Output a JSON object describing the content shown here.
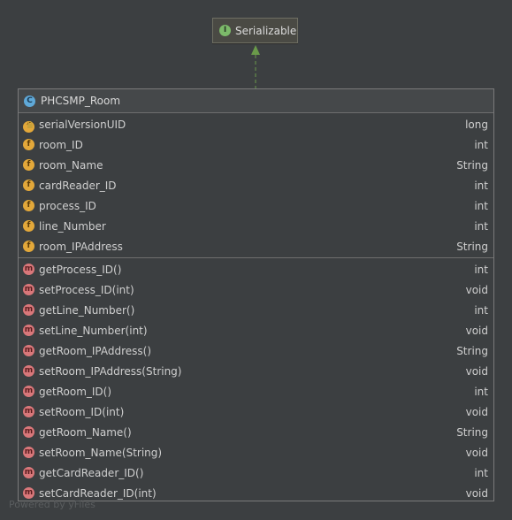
{
  "interface": {
    "name": "Serializable",
    "badge": "I"
  },
  "class": {
    "name": "PHCSMP_Room",
    "badge": "C",
    "fields": [
      {
        "name": "serialVersionUID",
        "type": "long",
        "badge": "f",
        "locked": true
      },
      {
        "name": "room_ID",
        "type": "int",
        "badge": "f"
      },
      {
        "name": "room_Name",
        "type": "String",
        "badge": "f"
      },
      {
        "name": "cardReader_ID",
        "type": "int",
        "badge": "f"
      },
      {
        "name": "process_ID",
        "type": "int",
        "badge": "f"
      },
      {
        "name": "line_Number",
        "type": "int",
        "badge": "f"
      },
      {
        "name": "room_IPAddress",
        "type": "String",
        "badge": "f"
      }
    ],
    "methods": [
      {
        "name": "getProcess_ID()",
        "type": "int",
        "badge": "m"
      },
      {
        "name": "setProcess_ID(int)",
        "type": "void",
        "badge": "m"
      },
      {
        "name": "getLine_Number()",
        "type": "int",
        "badge": "m"
      },
      {
        "name": "setLine_Number(int)",
        "type": "void",
        "badge": "m"
      },
      {
        "name": "getRoom_IPAddress()",
        "type": "String",
        "badge": "m"
      },
      {
        "name": "setRoom_IPAddress(String)",
        "type": "void",
        "badge": "m"
      },
      {
        "name": "getRoom_ID()",
        "type": "int",
        "badge": "m"
      },
      {
        "name": "setRoom_ID(int)",
        "type": "void",
        "badge": "m"
      },
      {
        "name": "getRoom_Name()",
        "type": "String",
        "badge": "m"
      },
      {
        "name": "setRoom_Name(String)",
        "type": "void",
        "badge": "m"
      },
      {
        "name": "getCardReader_ID()",
        "type": "int",
        "badge": "m"
      },
      {
        "name": "setCardReader_ID(int)",
        "type": "void",
        "badge": "m"
      }
    ]
  },
  "watermark": "Powered by yFiles",
  "colors": {
    "background": "#3c3f41",
    "arrow": "#6a9a4a",
    "field_badge": "#e3a83a",
    "method_badge": "#d9777a",
    "interface_badge": "#7cba6a",
    "class_badge": "#5fa9d9"
  }
}
